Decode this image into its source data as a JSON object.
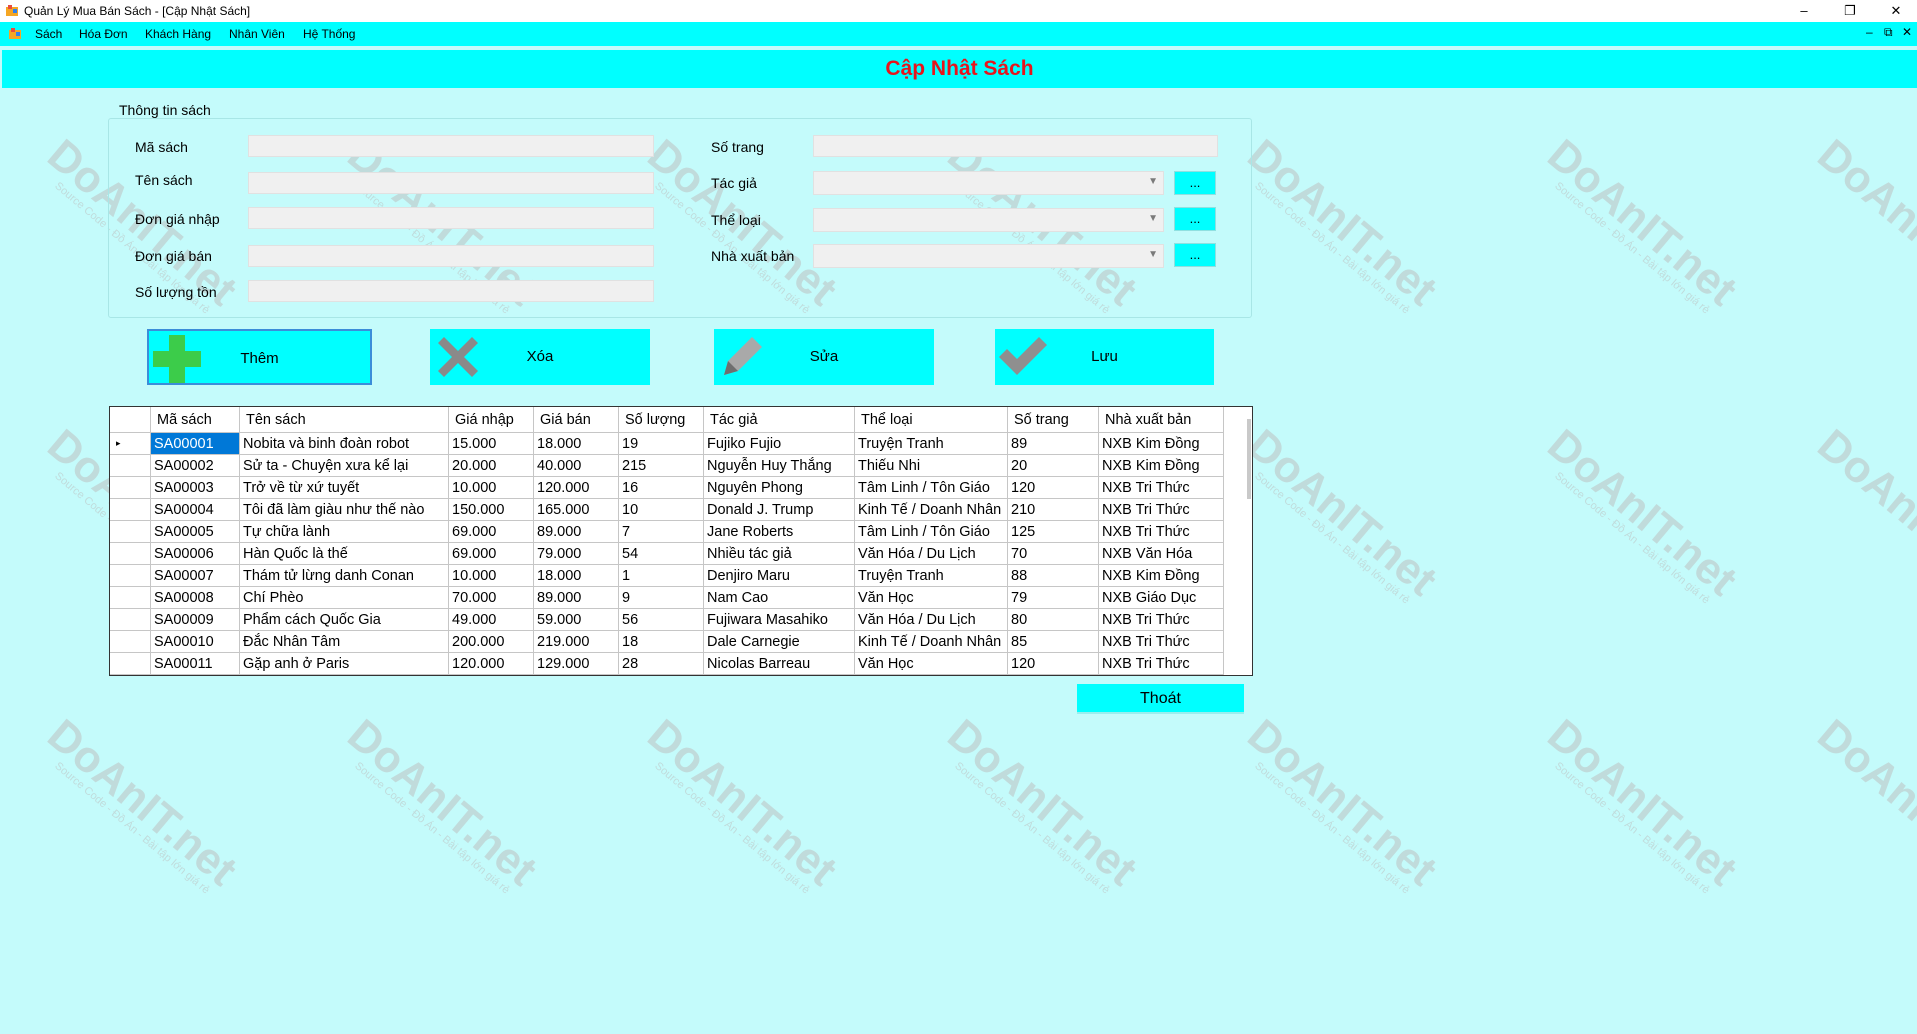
{
  "window": {
    "title": "Quản Lý Mua Bán Sách - [Cập Nhật Sách]",
    "controls": [
      "–",
      "❐",
      "✕"
    ]
  },
  "menubar": {
    "items": [
      "Sách",
      "Hóa Đơn",
      "Khách Hàng",
      "Nhân Viên",
      "Hệ Thống"
    ],
    "mdi_controls": [
      "–",
      "⧉",
      "✕"
    ]
  },
  "header": {
    "title": "Cập Nhật Sách"
  },
  "form": {
    "group_title": "Thông tin sách",
    "labels": {
      "ma_sach": "Mã sách",
      "ten_sach": "Tên sách",
      "don_gia_nhap": "Đơn giá nhập",
      "don_gia_ban": "Đơn giá bán",
      "so_luong_ton": "Số lượng tồn",
      "so_trang": "Số trang",
      "tac_gia": "Tác giả",
      "the_loai": "Thể loại",
      "nha_xuat_ban": "Nhà xuất bản"
    },
    "values": {
      "ma_sach": "",
      "ten_sach": "",
      "don_gia_nhap": "",
      "don_gia_ban": "",
      "so_luong_ton": "",
      "so_trang": "",
      "tac_gia": "",
      "the_loai": "",
      "nha_xuat_ban": ""
    },
    "browse_label": "..."
  },
  "actions": {
    "add": "Thêm",
    "delete": "Xóa",
    "edit": "Sửa",
    "save": "Lưu",
    "exit": "Thoát"
  },
  "grid": {
    "columns": [
      "Mã sách",
      "Tên sách",
      "Giá nhập",
      "Giá bán",
      "Số lượng",
      "Tác giả",
      "Thể loại",
      "Số trang",
      "Nhà xuất bản"
    ],
    "rows": [
      [
        "SA00001",
        "Nobita và binh đoàn robot",
        "15.000",
        "18.000",
        "19",
        "Fujiko Fujio",
        "Truyện Tranh",
        "89",
        "NXB Kim Đồng"
      ],
      [
        "SA00002",
        "Sử ta - Chuyện xưa kể lại",
        "20.000",
        "40.000",
        "215",
        "Nguyễn Huy Thắng",
        "Thiếu Nhi",
        "20",
        "NXB Kim Đồng"
      ],
      [
        "SA00003",
        "Trở về từ xứ tuyết",
        "10.000",
        "120.000",
        "16",
        "Nguyên Phong",
        "Tâm Linh / Tôn Giáo",
        "120",
        "NXB Tri Thức"
      ],
      [
        "SA00004",
        "Tôi đã làm giàu như thế nào",
        "150.000",
        "165.000",
        "10",
        "Donald J. Trump",
        "Kinh Tế / Doanh Nhân",
        "210",
        "NXB Tri Thức"
      ],
      [
        "SA00005",
        "Tự chữa lành",
        "69.000",
        "89.000",
        "7",
        "Jane Roberts",
        "Tâm Linh / Tôn Giáo",
        "125",
        "NXB Tri Thức"
      ],
      [
        "SA00006",
        "Hàn Quốc là thế",
        "69.000",
        "79.000",
        "54",
        "Nhiều tác giả",
        "Văn Hóa / Du Lịch",
        "70",
        "NXB Văn Hóa"
      ],
      [
        "SA00007",
        "Thám tử lừng danh Conan",
        "10.000",
        "18.000",
        "1",
        "Denjiro Maru",
        "Truyện Tranh",
        "88",
        "NXB Kim Đồng"
      ],
      [
        "SA00008",
        "Chí Phèo",
        "70.000",
        "89.000",
        "9",
        "Nam Cao",
        "Văn Học",
        "79",
        "NXB Giáo Dục"
      ],
      [
        "SA00009",
        "Phẩm cách Quốc Gia",
        "49.000",
        "59.000",
        "56",
        "Fujiwara Masahiko",
        "Văn Hóa / Du Lịch",
        "80",
        "NXB Tri Thức"
      ],
      [
        "SA00010",
        "Đắc Nhân Tâm",
        "200.000",
        "219.000",
        "18",
        "Dale Carnegie",
        "Kinh Tế / Doanh Nhân",
        "85",
        "NXB Tri Thức"
      ],
      [
        "SA00011",
        "Gặp anh ở Paris",
        "120.000",
        "129.000",
        "28",
        "Nicolas Barreau",
        "Văn Học",
        "120",
        "NXB Tri Thức"
      ]
    ],
    "selected_row": 0,
    "row_indicator": "▸"
  },
  "watermark": {
    "text": "DoAnIT.net",
    "subtext": "Source Code - Đồ Án - Bài tập lớn giá rẻ"
  },
  "colors": {
    "background": "#c4fbfb",
    "accent": "#00ffff",
    "title_text": "#e8141b",
    "selection": "#0078d7"
  }
}
